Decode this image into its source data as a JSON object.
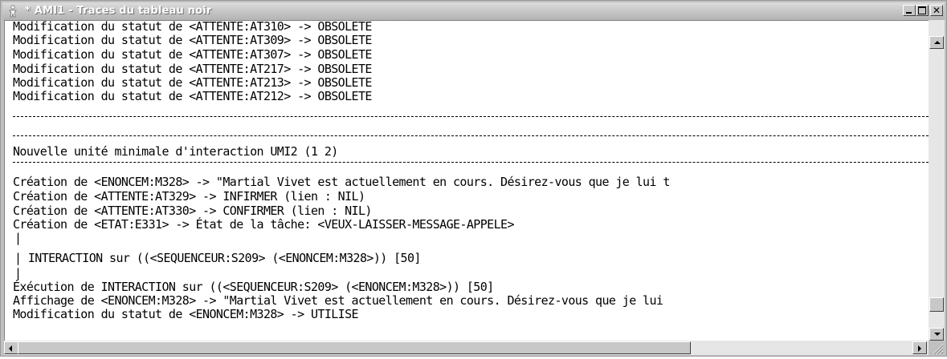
{
  "window": {
    "title": "* AMI1 - Traces du tableau noir",
    "icon": "app-figure-icon",
    "controls": {
      "minimize": "minimize-icon",
      "maximize": "maximize-icon",
      "close_glyph": "✕"
    }
  },
  "trace": {
    "block1": [
      "Modification du statut de <ATTENTE:AT310> -> OBSOLETE",
      "Modification du statut de <ATTENTE:AT309> -> OBSOLETE",
      "Modification du statut de <ATTENTE:AT307> -> OBSOLETE",
      "Modification du statut de <ATTENTE:AT217> -> OBSOLETE",
      "Modification du statut de <ATTENTE:AT213> -> OBSOLETE",
      "Modification du statut de <ATTENTE:AT212> -> OBSOLETE"
    ],
    "header": "Nouvelle unité minimale d'interaction UMI2 (1 2)",
    "block2": [
      "Création de <ENONCEM:M328> -> \"Martial Vivet est actuellement en cours. Désirez-vous que je lui t",
      "Création de <ATTENTE:AT329> -> INFIRMER (lien : NIL)",
      "Création de <ATTENTE:AT330> -> CONFIRMER (lien : NIL)",
      "Création de <ETAT:E331> -> État de la tâche: <VEUX-LAISSER-MESSAGE-APPELE>"
    ],
    "pipe": "|",
    "interaction": "| INTERACTION sur ((<SEQUENCEUR:S209> (<ENONCEM:M328>)) [50]",
    "block3": [
      "Éxécution de INTERACTION sur ((<SEQUENCEUR:S209> (<ENONCEM:M328>)) [50]",
      "Affichage de <ENONCEM:M328> -> \"Martial Vivet est actuellement en cours. Désirez-vous que je lui",
      "Modification du statut de <ENONCEM:M328> -> UTILISE"
    ]
  },
  "scrollbars": {
    "vertical_position": 0.96,
    "horizontal_position": 0.0,
    "horizontal_visible_fraction": 0.74
  }
}
